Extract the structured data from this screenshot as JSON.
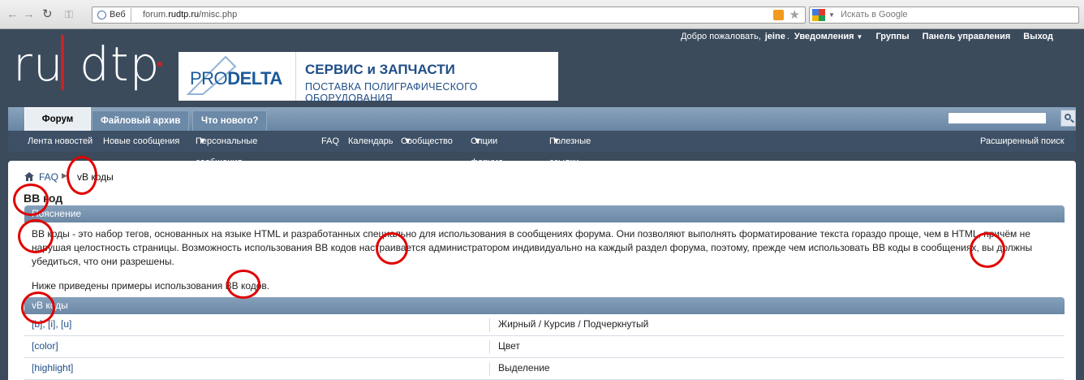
{
  "browser": {
    "web_label": "Веб",
    "url_prefix": "forum.",
    "url_domain": "rudtp.ru",
    "url_path": "/misc.php",
    "search_placeholder": "Искать в Google"
  },
  "header": {
    "logo_text": "ru dtp",
    "banner_brand_a": "PRO",
    "banner_brand_b": "DELTA",
    "banner_line1": "СЕРВИС и ЗАПЧАСТИ",
    "banner_line2": "ПОСТАВКА ПОЛИГРАФИЧЕСКОГО ОБОРУДОВАНИЯ",
    "welcome": "Добро пожаловать,",
    "username": "jeine",
    "links": [
      "Уведомления",
      "Группы",
      "Панель управления",
      "Выход"
    ]
  },
  "navbar": {
    "tabs": [
      "Форум",
      "Файловый архив",
      "Что нового?"
    ],
    "subnav": [
      "Лента новостей",
      "Новые сообщения",
      "Персональные сообщения",
      "FAQ",
      "Календарь",
      "Сообщество",
      "Опции форума",
      "Полезные ссылки"
    ],
    "advanced_search": "Расширенный поиск"
  },
  "breadcrumb": {
    "parent": "FAQ",
    "current": "vB коды"
  },
  "page_title": "BB код",
  "explanation": {
    "header": "Пояснение",
    "text": "BB коды - это набор тегов, основанных на языке HTML и разработанных специально для использования в сообщениях форума. Они позволяют выполнять форматирование текста гораздо проще, чем в HTML, причём не нарушая целостность страницы. Возможность использования BB кодов настраивается администратором индивидуально на каждый раздел форума, поэтому, прежде чем использовать BB коды в сообщениях, вы должны убедиться, что они разрешены.",
    "examples_note": "Ниже приведены примеры использования BB кодов."
  },
  "vb_codes": {
    "header": "vB коды",
    "rows": [
      {
        "code": "[b], [i], [u]",
        "desc": "Жирный / Курсив / Подчеркнутый"
      },
      {
        "code": "[color]",
        "desc": "Цвет"
      },
      {
        "code": "[highlight]",
        "desc": "Выделение"
      }
    ]
  },
  "colors": {
    "header_bg": "#3b4b5c",
    "tab_bar": "#7993ae",
    "subnav_bg": "#3d5066",
    "link": "#1f4e87",
    "annotation": "#e00000"
  }
}
